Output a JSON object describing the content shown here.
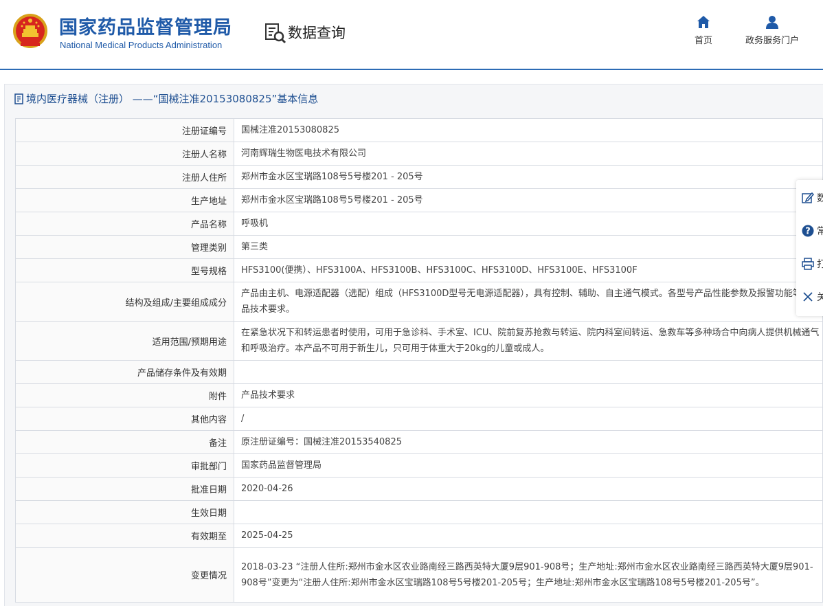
{
  "header": {
    "org_name_cn": "国家药品监督管理局",
    "org_name_en": "National Medical Products Administration",
    "section_title": "数据查询",
    "nav": [
      {
        "label": "首页",
        "icon": "home-icon"
      },
      {
        "label": "政务服务门户",
        "icon": "user-icon"
      }
    ]
  },
  "panel": {
    "title": "境内医疗器械（注册） ——“国械注准20153080825”基本信息"
  },
  "side_tools": [
    {
      "icon": "edit-icon",
      "label": "数"
    },
    {
      "icon": "help-icon",
      "label": "常"
    },
    {
      "icon": "print-icon",
      "label": "打"
    },
    {
      "icon": "close-icon",
      "label": "关"
    }
  ],
  "fields": [
    {
      "label": "注册证编号",
      "value": "国械注准20153080825"
    },
    {
      "label": "注册人名称",
      "value": "河南辉瑞生物医电技术有限公司"
    },
    {
      "label": "注册人住所",
      "value": "郑州市金水区宝瑞路108号5号楼201 - 205号"
    },
    {
      "label": "生产地址",
      "value": "郑州市金水区宝瑞路108号5号楼201 - 205号"
    },
    {
      "label": "产品名称",
      "value": "呼吸机"
    },
    {
      "label": "管理类别",
      "value": "第三类"
    },
    {
      "label": "型号规格",
      "value": "HFS3100(便携）、HFS3100A、HFS3100B、HFS3100C、HFS3100D、HFS3100E、HFS3100F"
    },
    {
      "label": "结构及组成/主要组成成分",
      "value": "产品由主机、电源适配器（选配）组成（HFS3100D型号无电源适配器），具有控制、辅助、自主通气模式。各型号产品性能参数及报警功能等见产品技术要求。"
    },
    {
      "label": "适用范围/预期用途",
      "value": "在紧急状况下和转运患者时使用，可用于急诊科、手术室、ICU、院前复苏抢救与转运、院内科室间转运、急救车等多种场合中向病人提供机械通气和呼吸治疗。本产品不可用于新生儿，只可用于体重大于20kg的儿童或成人。"
    },
    {
      "label": "产品储存条件及有效期",
      "value": ""
    },
    {
      "label": "附件",
      "value": "产品技术要求"
    },
    {
      "label": "其他内容",
      "value": "/"
    },
    {
      "label": "备注",
      "value": "原注册证编号：国械注准20153540825"
    },
    {
      "label": "审批部门",
      "value": "国家药品监督管理局"
    },
    {
      "label": "批准日期",
      "value": "2020-04-26"
    },
    {
      "label": "生效日期",
      "value": ""
    },
    {
      "label": "有效期至",
      "value": "2025-04-25"
    },
    {
      "label": "变更情况",
      "value": "2018-03-23 “注册人住所:郑州市金水区农业路南经三路西英特大厦9层901-908号；生产地址:郑州市金水区农业路南经三路西英特大厦9层901-908号”变更为“注册人住所:郑州市金水区宝瑞路108号5号楼201-205号；生产地址:郑州市金水区宝瑞路108号5号楼201-205号”。"
    }
  ],
  "colors": {
    "brand_blue": "#1f5aa8",
    "title_blue": "#1e4f91",
    "header_border": "#2c6bb5"
  }
}
